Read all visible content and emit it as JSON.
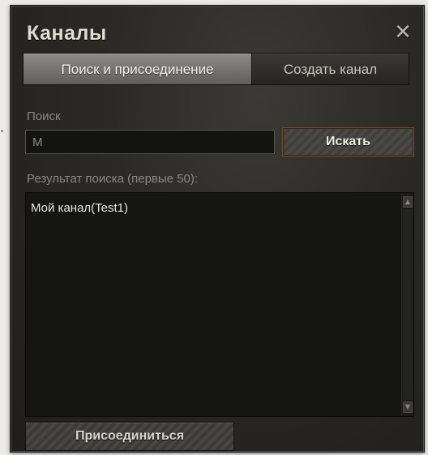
{
  "window": {
    "title": "Каналы",
    "close_icon": "close-icon"
  },
  "outside": {
    "glyph": "·"
  },
  "tabs": [
    {
      "label": "Поиск и присоединение",
      "active": true
    },
    {
      "label": "Создать канал",
      "active": false
    }
  ],
  "search": {
    "label": "Поиск",
    "value": "М",
    "button_label": "Искать"
  },
  "results": {
    "label": "Результат поиска (первые 50):",
    "items": [
      "Мой канал(Test1)"
    ]
  },
  "actions": {
    "join_label": "Присоединиться"
  },
  "colors": {
    "panel_background": "#2a2926",
    "title_text": "#e0ddcf",
    "active_tab": "#8d8b85",
    "search_button_border": "#7a4a2e"
  }
}
